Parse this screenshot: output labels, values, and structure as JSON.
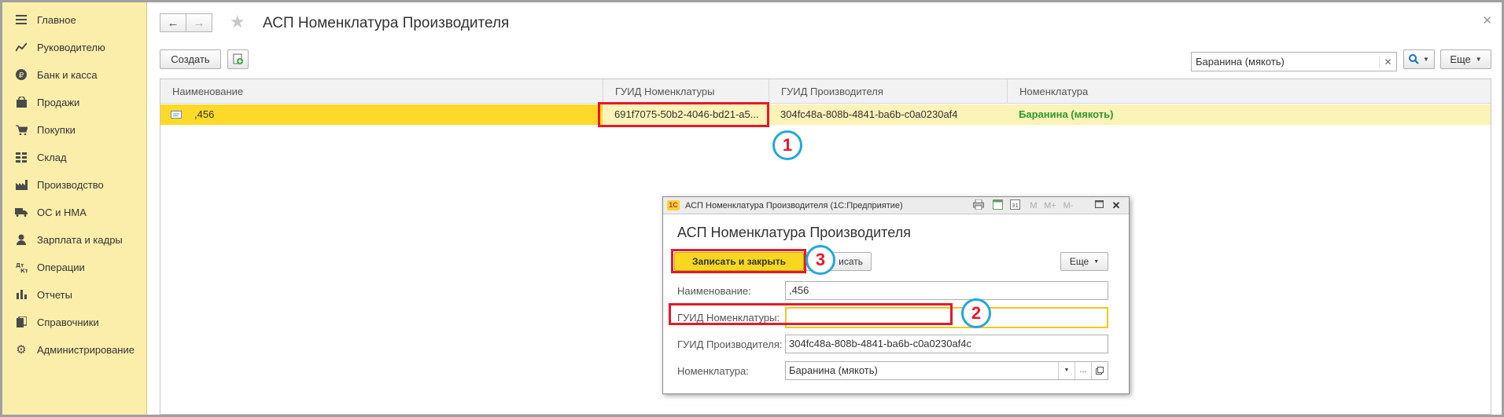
{
  "sidebar": {
    "items": [
      {
        "label": "Главное",
        "icon": "menu-lines-icon"
      },
      {
        "label": "Руководителю",
        "icon": "chart-line-icon"
      },
      {
        "label": "Банк и касса",
        "icon": "ruble-coin-icon"
      },
      {
        "label": "Продажи",
        "icon": "shopping-bag-icon"
      },
      {
        "label": "Покупки",
        "icon": "shopping-cart-icon"
      },
      {
        "label": "Склад",
        "icon": "warehouse-grid-icon"
      },
      {
        "label": "Производство",
        "icon": "factory-icon"
      },
      {
        "label": "ОС и НМА",
        "icon": "truck-icon"
      },
      {
        "label": "Зарплата и кадры",
        "icon": "person-icon"
      },
      {
        "label": "Операции",
        "icon": "dt-kt-icon"
      },
      {
        "label": "Отчеты",
        "icon": "bar-chart-icon"
      },
      {
        "label": "Справочники",
        "icon": "books-icon"
      },
      {
        "label": "Администрирование",
        "icon": "gear-icon"
      }
    ]
  },
  "header": {
    "title": "АСП Номенклатура Производителя"
  },
  "toolbar": {
    "create_label": "Создать",
    "search_value": "Баранина (мякоть)",
    "more_label": "Еще"
  },
  "table": {
    "columns": [
      "Наименование",
      "ГУИД Номенклатуры",
      "ГУИД Производителя",
      "Номенклатура"
    ],
    "rows": [
      {
        "name": ",456",
        "guid_nom": "691f7075-50b2-4046-bd21-a5...",
        "guid_maker": "304fc48a-808b-4841-ba6b-c0a0230af4",
        "nomenclature": "Баранина (мякоть)"
      }
    ]
  },
  "annotations": {
    "one": "1",
    "two": "2",
    "three": "3"
  },
  "dialog": {
    "window_title": "АСП Номенклатура Производителя  (1С:Предприятие)",
    "heading": "АСП Номенклатура Производителя",
    "save_close_label": "Записать и закрыть",
    "save_label": "Записать",
    "save_label_visible": "исать",
    "more_label": "Еще",
    "toolbar_m": "M",
    "toolbar_mplus": "M+",
    "toolbar_mminus": "M-",
    "fields": {
      "name_label": "Наименование:",
      "name_value": ",456",
      "guid_nom_label": "ГУИД Номенклатуры:",
      "guid_nom_value": "",
      "guid_maker_label": "ГУИД Производителя:",
      "guid_maker_value": "304fc48a-808b-4841-ba6b-c0a0230af4c",
      "nomenclature_label": "Номенклатура:",
      "nomenclature_value": "Баранина (мякоть)"
    }
  },
  "colors": {
    "sidebar_bg": "#fbeeaa",
    "row_highlight": "#fbf3b8",
    "cell_selected": "#fdd92a",
    "link_green": "#2e9a2e",
    "annotation_red": "#e6192a",
    "annotation_blue": "#22a6e0"
  }
}
